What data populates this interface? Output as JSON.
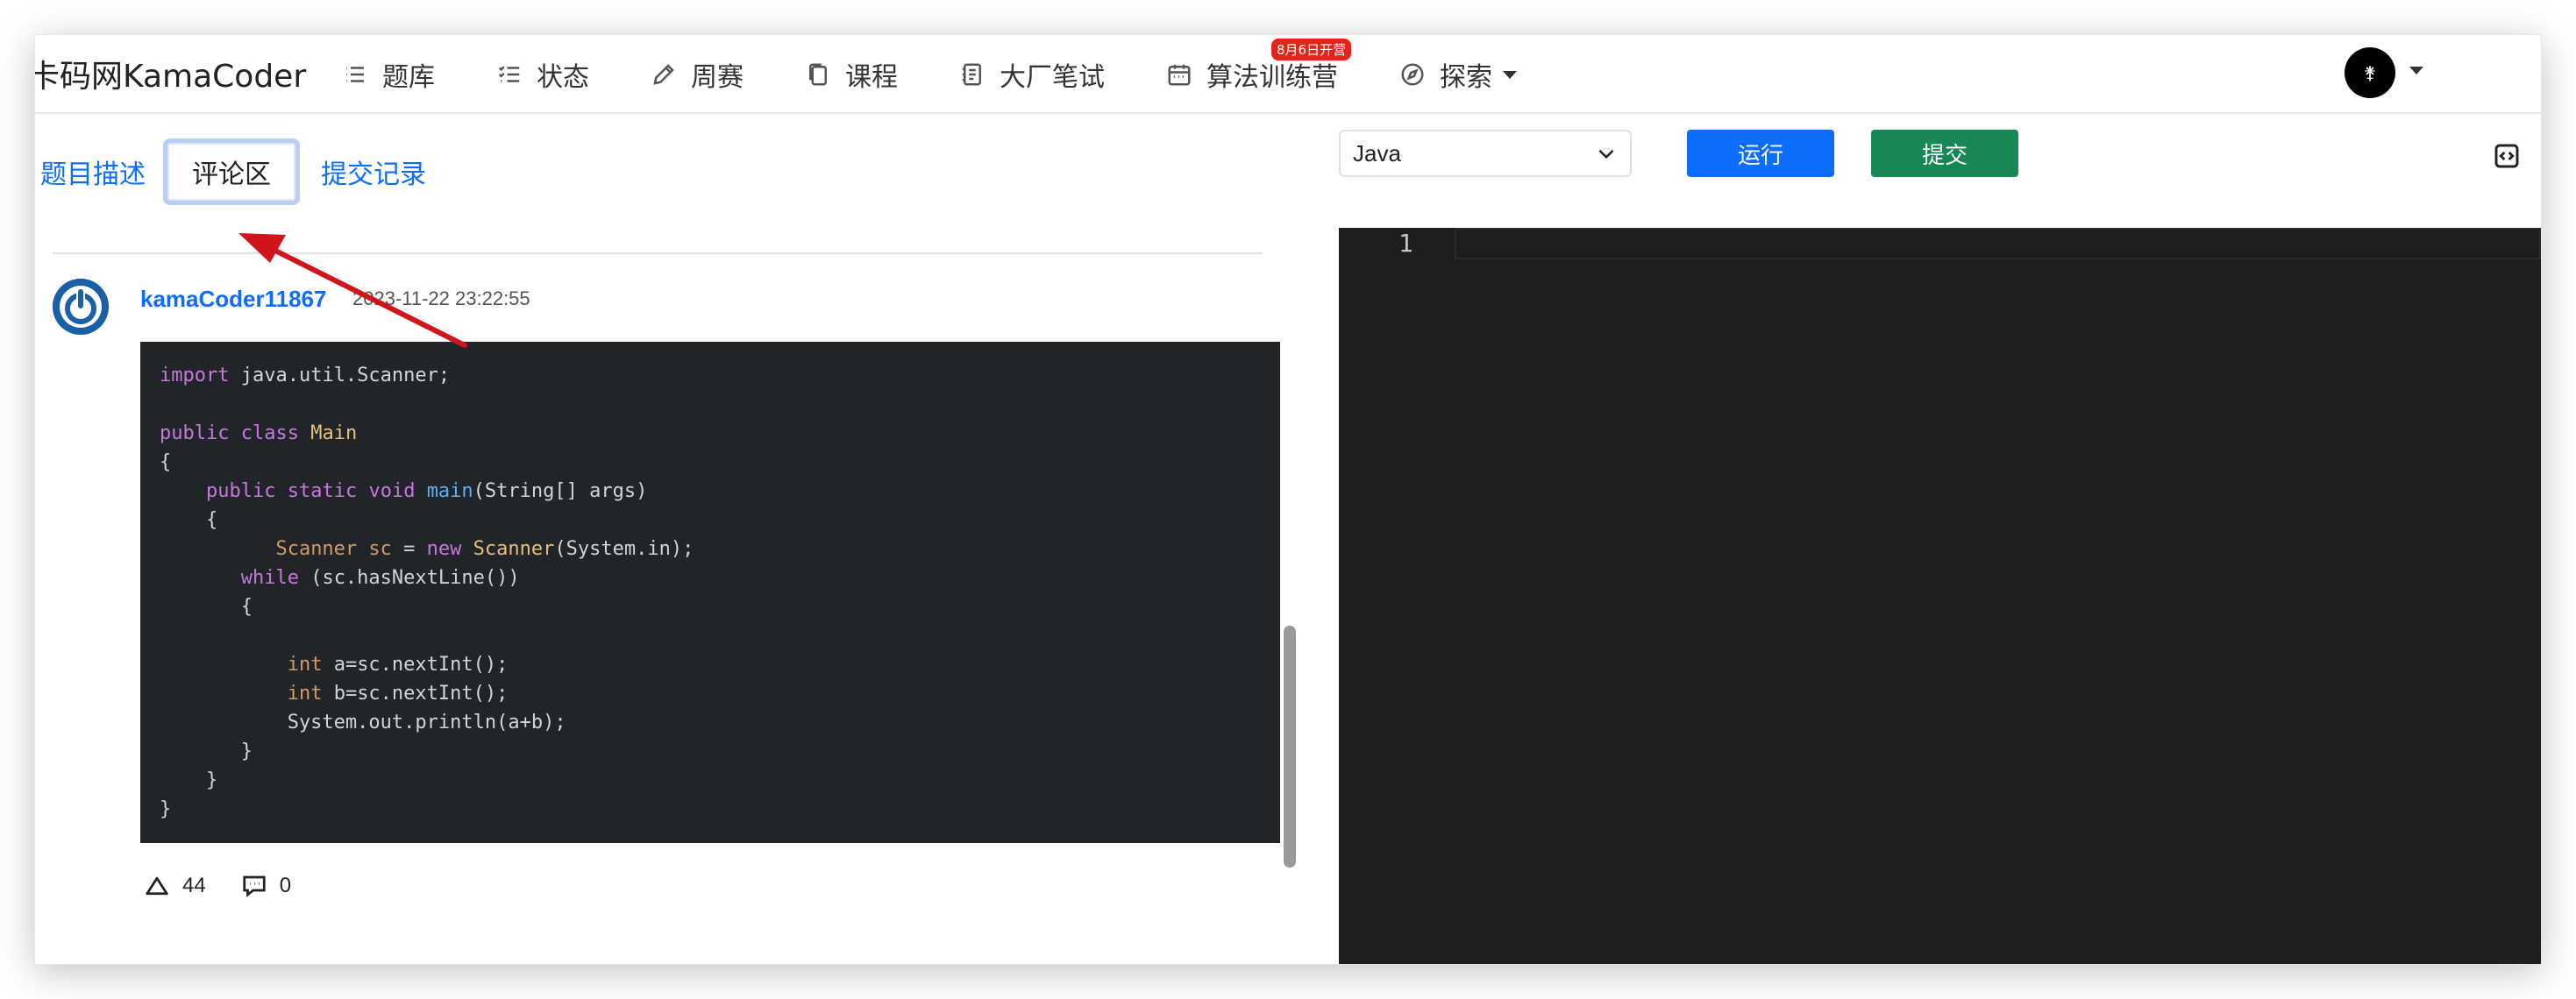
{
  "navbar": {
    "brand": "卡码网KamaCoder",
    "items": [
      {
        "label": "题库",
        "icon": "list-icon"
      },
      {
        "label": "状态",
        "icon": "checklist-icon"
      },
      {
        "label": "周赛",
        "icon": "pencil-icon"
      },
      {
        "label": "课程",
        "icon": "copy-icon"
      },
      {
        "label": "大厂笔试",
        "icon": "journal-icon"
      },
      {
        "label": "算法训练营",
        "icon": "calendar-icon",
        "badge": "8月6日开营"
      },
      {
        "label": "探索",
        "icon": "compass-icon"
      }
    ],
    "user_avatar_glyph": "⚵"
  },
  "tabs": [
    {
      "label": "题目描述"
    },
    {
      "label": "评论区",
      "active": true
    },
    {
      "label": "提交记录"
    }
  ],
  "comment": {
    "username": "kamaCoder11867",
    "timestamp": "2023-11-22 23:22:55",
    "likes": "44",
    "replies": "0"
  },
  "editor_panel": {
    "language": "Java",
    "run_label": "运行",
    "submit_label": "提交",
    "line_number": "1"
  },
  "colors": {
    "primary": "#0d6efd",
    "success": "#198754",
    "code_bg": "#212529",
    "editor_bg": "#1e1e1e",
    "annotation": "#d0141c"
  }
}
